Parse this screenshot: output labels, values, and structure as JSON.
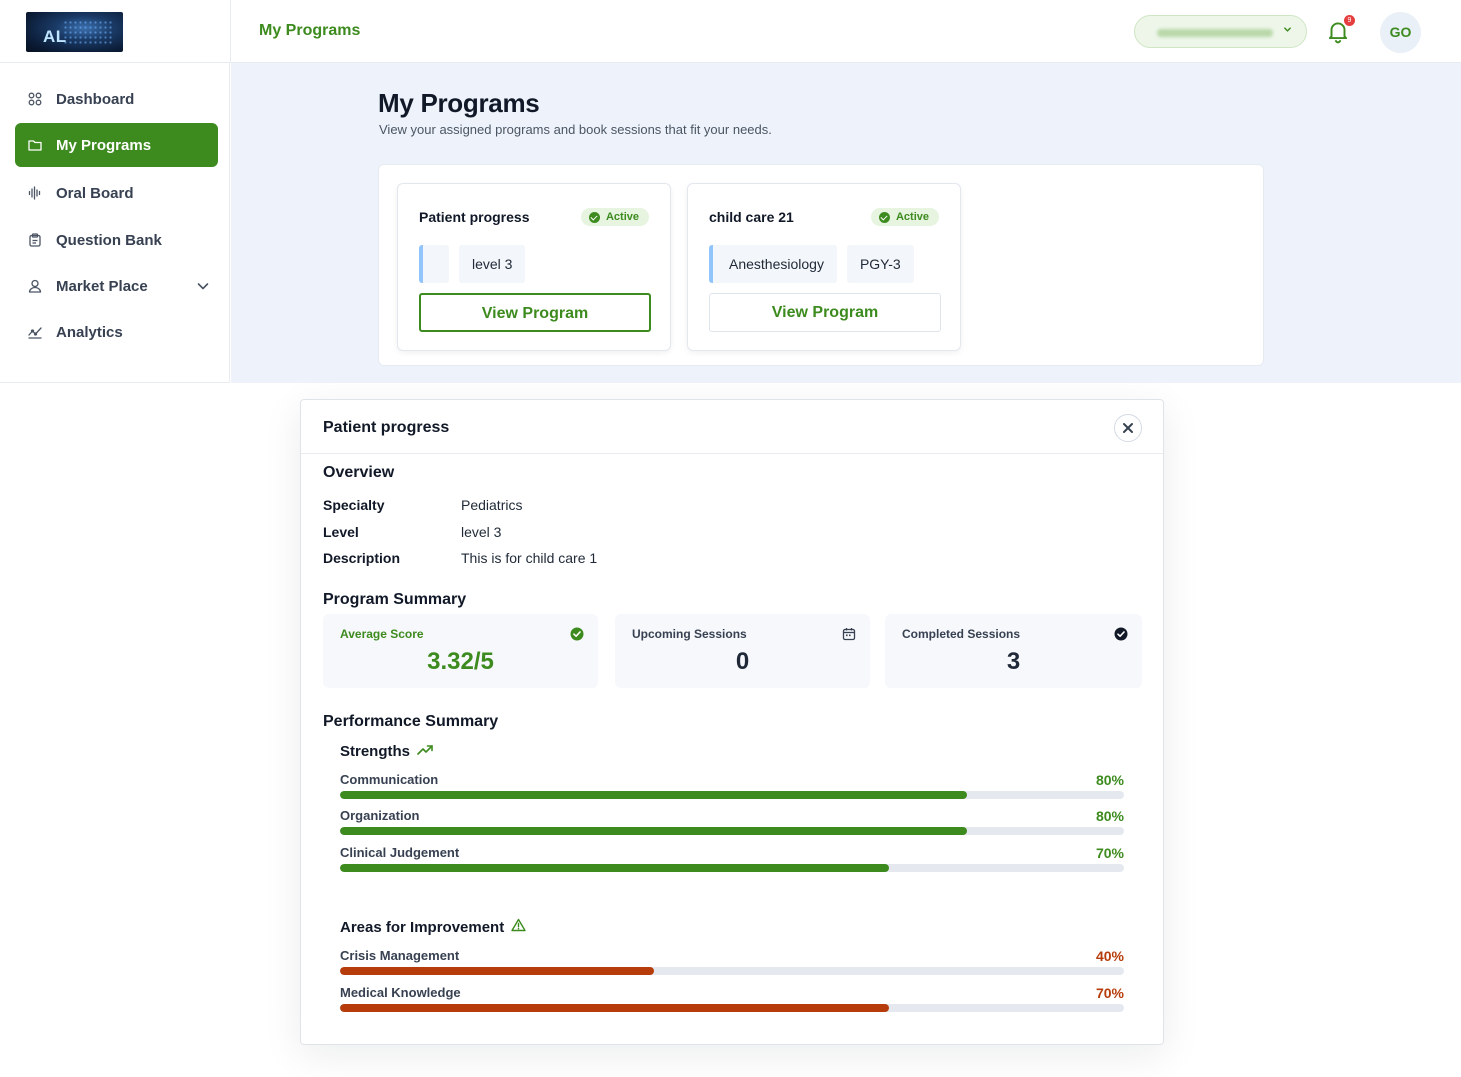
{
  "app": {
    "logo_text": "AL",
    "top_title": "My Programs",
    "notifications_count": "9",
    "avatar_initials": "GO"
  },
  "sidebar": {
    "items": [
      {
        "label": "Dashboard",
        "icon": "grid-icon"
      },
      {
        "label": "My Programs",
        "icon": "folder-icon",
        "active": true
      },
      {
        "label": "Oral Board",
        "icon": "waveform-icon"
      },
      {
        "label": "Question Bank",
        "icon": "clipboard-icon"
      },
      {
        "label": "Market Place",
        "icon": "user-icon",
        "expandable": true
      },
      {
        "label": "Analytics",
        "icon": "analytics-icon"
      }
    ]
  },
  "page": {
    "title": "My Programs",
    "subtitle": "View your assigned programs and book sessions that fit your needs."
  },
  "programs": [
    {
      "name": "Patient progress",
      "status": "Active",
      "chips": [
        "level 3"
      ],
      "button": "View Program"
    },
    {
      "name": "child care 21",
      "status": "Active",
      "chips": [
        "Anesthesiology",
        "PGY-3"
      ],
      "button": "View Program"
    }
  ],
  "modal": {
    "title": "Patient progress",
    "overview_title": "Overview",
    "overview": [
      {
        "key": "Specialty",
        "value": "Pediatrics"
      },
      {
        "key": "Level",
        "value": "level 3"
      },
      {
        "key": "Description",
        "value": "This is for child care 1"
      }
    ],
    "summary_title": "Program Summary",
    "stats": [
      {
        "label": "Average Score",
        "value": "3.32/5",
        "icon": "check-circle-icon"
      },
      {
        "label": "Upcoming Sessions",
        "value": "0",
        "icon": "calendar-icon"
      },
      {
        "label": "Completed Sessions",
        "value": "3",
        "icon": "check-circle-icon"
      }
    ],
    "performance_title": "Performance Summary",
    "strengths_title": "Strengths",
    "strengths": [
      {
        "label": "Communication",
        "percent": 80,
        "display": "80%"
      },
      {
        "label": "Organization",
        "percent": 80,
        "display": "80%"
      },
      {
        "label": "Clinical Judgement",
        "percent": 70,
        "display": "70%"
      }
    ],
    "improvement_title": "Areas for Improvement",
    "improvements": [
      {
        "label": "Crisis Management",
        "percent": 40,
        "display": "40%"
      },
      {
        "label": "Medical Knowledge",
        "percent": 70,
        "display": "70%"
      }
    ]
  },
  "colors": {
    "brand_green": "#3d8b1f",
    "improvement_red": "#b63d0b",
    "page_bg": "#eef3fb"
  }
}
